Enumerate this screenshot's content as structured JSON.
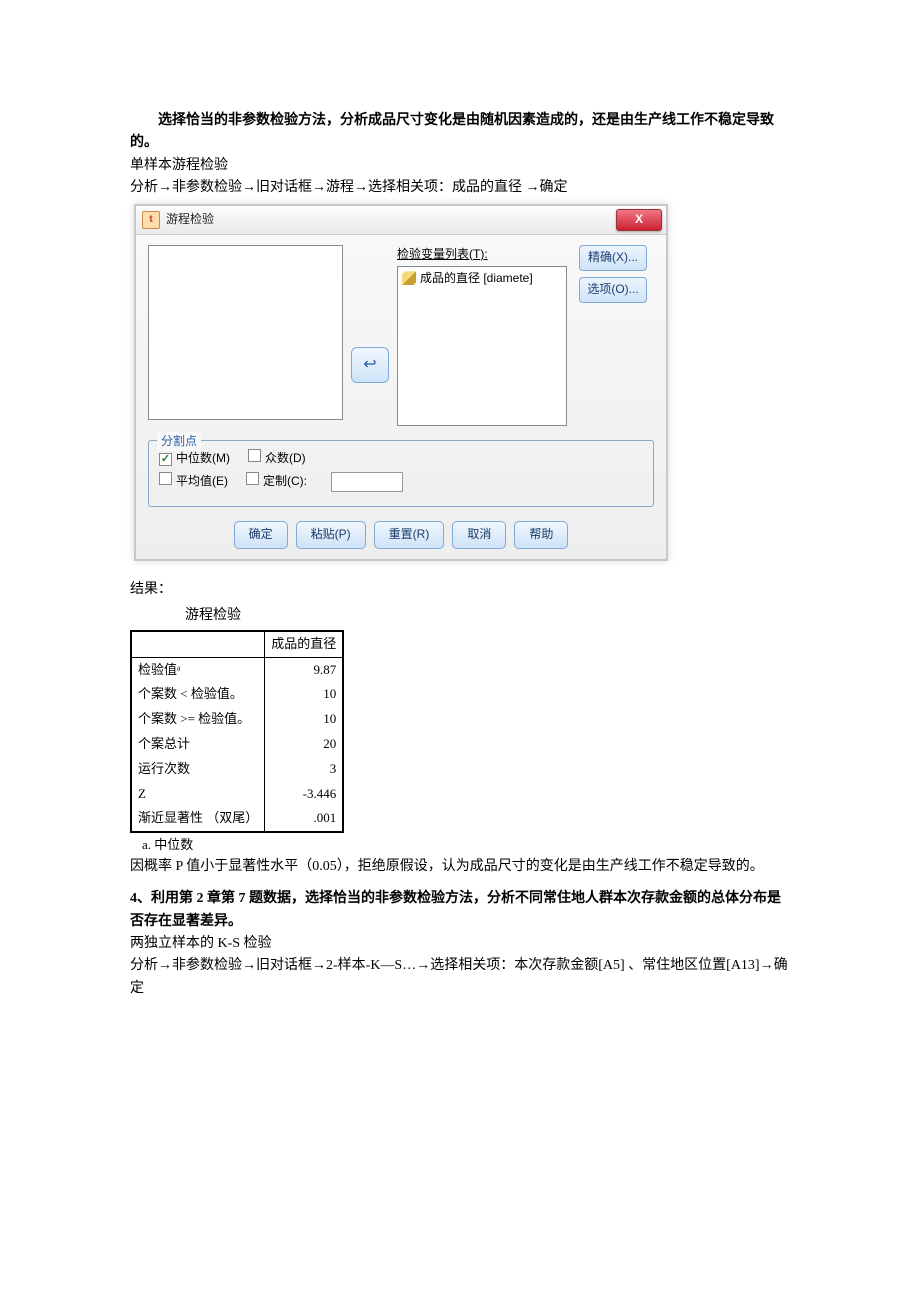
{
  "intro": {
    "bold_line": "选择恰当的非参数检验方法，分析成品尺寸变化是由随机因素造成的，还是由生产线工作不稳定导致的。",
    "line2": "单样本游程检验",
    "line3": "分析→非参数检验→旧对话框→游程→选择相关项：成品的直径 →确定"
  },
  "dialog": {
    "title": "游程检验",
    "close": "X",
    "list_label": "检验变量列表(T):",
    "list_item": "成品的直径 [diamete]",
    "move_arrow": "↩",
    "side": {
      "exact": "精确(X)...",
      "options": "选项(O)..."
    },
    "cutpoint": {
      "legend": "分割点",
      "median": "中位数(M)",
      "mode": "众数(D)",
      "mean": "平均值(E)",
      "custom": "定制(C):"
    },
    "buttons": {
      "ok": "确定",
      "paste": "粘贴(P)",
      "reset": "重置(R)",
      "cancel": "取消",
      "help": "帮助"
    }
  },
  "results": {
    "label": "结果：",
    "tbl_title": "游程检验",
    "header_col2": "成品的直径",
    "rows": [
      {
        "k": "检验值ᵃ",
        "v": "9.87"
      },
      {
        "k": "个案数 < 检验值。",
        "v": "10"
      },
      {
        "k": "个案数 >= 检验值。",
        "v": "10"
      },
      {
        "k": "个案总计",
        "v": "20"
      },
      {
        "k": "运行次数",
        "v": "3"
      },
      {
        "k": "Z",
        "v": "-3.446"
      },
      {
        "k": "渐近显著性 （双尾）",
        "v": ".001"
      }
    ],
    "footnote": "a. 中位数",
    "conclusion": "因概率 P 值小于显著性水平（0.05），拒绝原假设，认为成品尺寸的变化是由生产线工作不稳定导致的。"
  },
  "q4": {
    "title": "4、利用第 2 章第 7 题数据，选择恰当的非参数检验方法，分析不同常住地人群本次存款金额的总体分布是否存在显著差异。",
    "line2": "两独立样本的 K-S 检验",
    "line3": "分析→非参数检验→旧对话框→2-样本-K—S…→选择相关项：本次存款金额[A5] 、常住地区位置[A13]→确定"
  },
  "chart_data": {
    "type": "table",
    "title": "游程检验",
    "columns": [
      "",
      "成品的直径"
    ],
    "rows": [
      [
        "检验值a",
        9.87
      ],
      [
        "个案数 < 检验值。",
        10
      ],
      [
        "个案数 >= 检验值。",
        10
      ],
      [
        "个案总计",
        20
      ],
      [
        "运行次数",
        3
      ],
      [
        "Z",
        -3.446
      ],
      [
        "渐近显著性 （双尾）",
        0.001
      ]
    ],
    "footnote": "a. 中位数"
  }
}
